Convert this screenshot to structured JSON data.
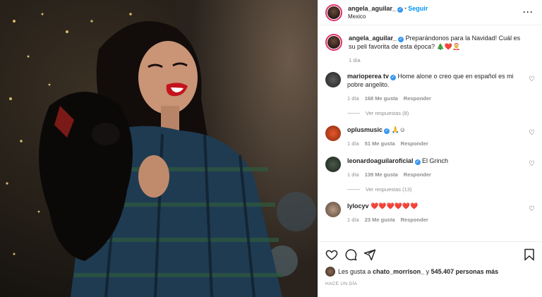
{
  "header": {
    "username": "angela_aguilar_",
    "follow_label": "Seguir",
    "location": "Mexico",
    "separator": "•"
  },
  "caption": {
    "username": "angela_aguilar_",
    "text": "Preparándonos para la Navidad! Cuál es su peli favorita de esta época? 🎄❤️🤶",
    "time": "1 día"
  },
  "comments": [
    {
      "username": "marioperea tv",
      "text": "Home alone o creo que en español es mi pobre angelito.",
      "time": "1 día",
      "likes": "168 Me gusta",
      "reply": "Responder",
      "view_replies": "Ver respuestas (8)"
    },
    {
      "username": "oplusmusic",
      "text": "🙏☺",
      "time": "1 día",
      "likes": "51 Me gusta",
      "reply": "Responder"
    },
    {
      "username": "leonardoaguilaroficial",
      "text": "El Grinch",
      "time": "1 día",
      "likes": "139 Me gusta",
      "reply": "Responder",
      "view_replies": "Ver respuestas (13)"
    },
    {
      "username": "lylocyv",
      "text": "❤️❤️❤️❤️❤️❤️",
      "time": "1 día",
      "likes": "23 Me gusta",
      "reply": "Responder"
    }
  ],
  "likes": {
    "prefix": "Les gusta a",
    "user": "chato_morrison_",
    "conj": "y",
    "others": "545.407 personas más"
  },
  "time_ago": "HACE UN DÍA",
  "icons": [
    "heart-icon",
    "comment-icon",
    "share-icon",
    "bookmark-icon",
    "more-options-icon",
    "verified-icon"
  ],
  "colors": {
    "follow": "#0095f6",
    "verified": "#3897f0",
    "muted": "#8e8e8e"
  }
}
